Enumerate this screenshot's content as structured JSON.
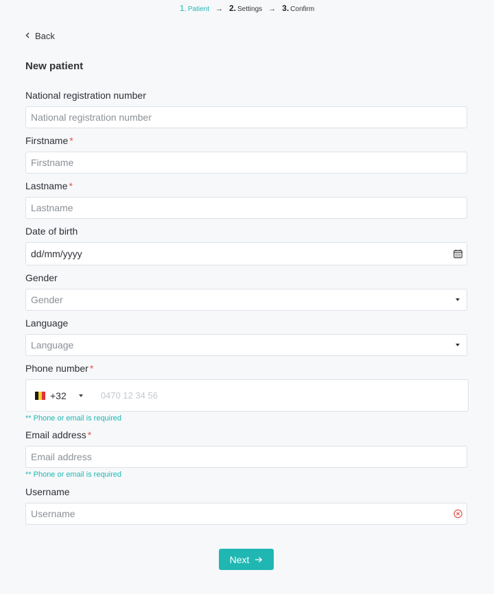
{
  "stepper": {
    "steps": [
      {
        "num": "1.",
        "label": "Patient"
      },
      {
        "num": "2.",
        "label": "Settings"
      },
      {
        "num": "3.",
        "label": "Confirm"
      }
    ],
    "arrow": "→"
  },
  "back_label": "Back",
  "title": "New patient",
  "fields": {
    "nrn": {
      "label": "National registration number",
      "placeholder": "National registration number"
    },
    "firstname": {
      "label": "Firstname",
      "required": "*",
      "placeholder": "Firstname"
    },
    "lastname": {
      "label": "Lastname",
      "required": "*",
      "placeholder": "Lastname"
    },
    "dob": {
      "label": "Date of birth",
      "value": "dd/mm/yyyy"
    },
    "gender": {
      "label": "Gender",
      "placeholder": "Gender"
    },
    "language": {
      "label": "Language",
      "placeholder": "Language"
    },
    "phone": {
      "label": "Phone number",
      "required": "*",
      "dial_code": "+32",
      "placeholder": "0470 12 34 56",
      "hint": "** Phone or email is required"
    },
    "email": {
      "label": "Email address",
      "required": "*",
      "placeholder": "Email address",
      "hint": "** Phone or email is required"
    },
    "username": {
      "label": "Username",
      "placeholder": "Username"
    }
  },
  "next_label": "Next",
  "icons": {
    "calendar": "calendar-icon",
    "error": "error-circle-icon",
    "flag": "belgium-flag-icon",
    "next_arrow": "arrow-right-icon"
  },
  "colors": {
    "accent": "#20b7b3",
    "required": "#e5534b",
    "error": "#e5534b"
  }
}
